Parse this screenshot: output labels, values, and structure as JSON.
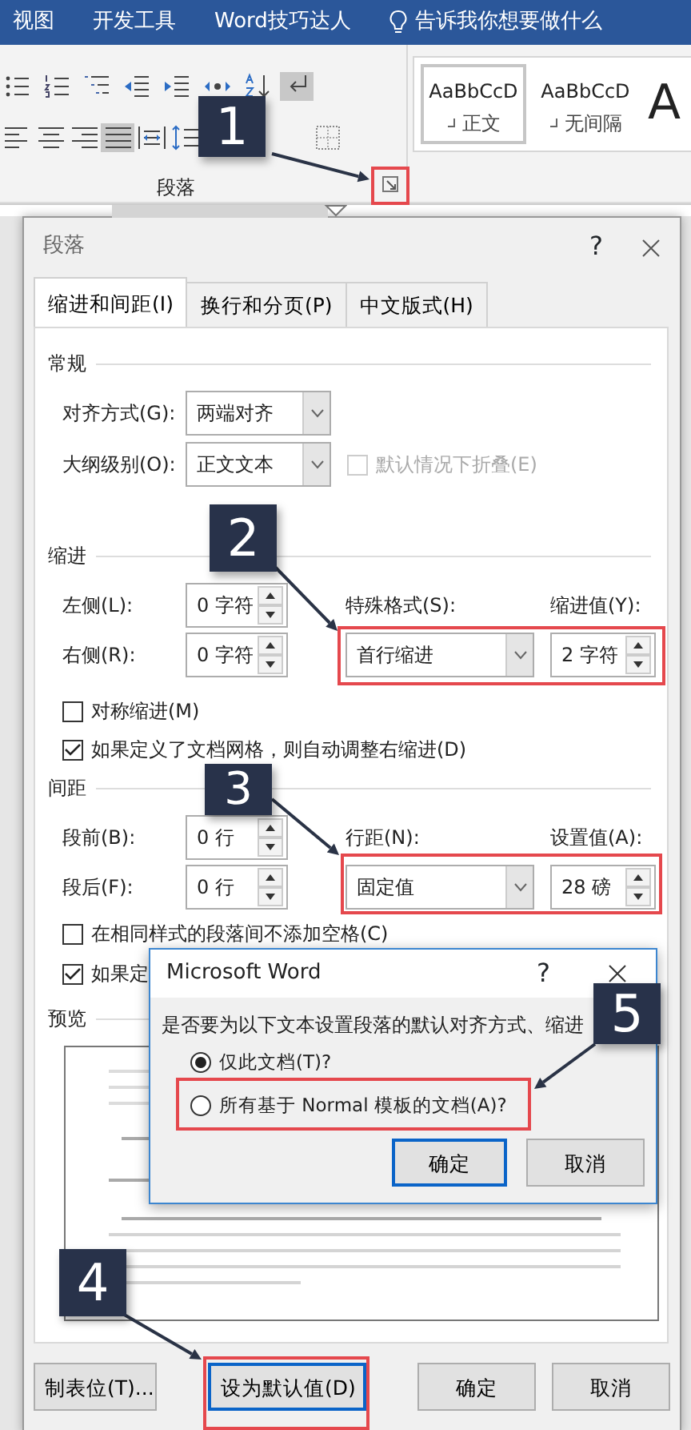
{
  "ribbon_tabs": [
    {
      "label": "视图"
    },
    {
      "label": "开发工具"
    },
    {
      "label": "Word技巧达人"
    }
  ],
  "tell_me": "告诉我你想要做什么",
  "tool_rows": [
    [
      {
        "kind": "bullets",
        "selected": false
      },
      {
        "kind": "numbering",
        "selected": false
      },
      {
        "kind": "multilevel",
        "selected": false
      },
      {
        "kind": "outdent",
        "selected": false
      },
      {
        "kind": "indent",
        "selected": false
      },
      {
        "kind": "asian",
        "selected": false
      },
      {
        "kind": "sort",
        "selected": false
      },
      {
        "kind": "marks",
        "selected": true
      }
    ],
    [
      {
        "kind": "align-left",
        "selected": false
      },
      {
        "kind": "align-center",
        "selected": false
      },
      {
        "kind": "align-right",
        "selected": false
      },
      {
        "kind": "justify",
        "selected": true
      },
      {
        "kind": "distribute",
        "selected": false
      },
      {
        "kind": "line-spacing",
        "selected": false
      },
      {
        "kind": "spacer"
      },
      {
        "kind": "borders",
        "selected": false
      }
    ]
  ],
  "group_label": "段落",
  "styles": [
    {
      "kind": "normal",
      "sample": "AaBbCcD",
      "name": "正文",
      "selected": true
    },
    {
      "kind": "normal",
      "sample": "AaBbCcD",
      "name": "无间隔",
      "selected": false
    },
    {
      "kind": "heading",
      "sample": "A",
      "selected": false
    }
  ],
  "dialog": {
    "title": "段落",
    "help": "?",
    "tabs": [
      {
        "label": "缩进和间距(I)",
        "selected": true
      },
      {
        "label": "换行和分页(P)",
        "selected": false
      },
      {
        "label": "中文版式(H)",
        "selected": false
      }
    ],
    "general": {
      "heading": "常规",
      "alignment": {
        "label": "对齐方式(G):",
        "value": "两端对齐"
      },
      "outline": {
        "label": "大纲级别(O):",
        "value": "正文文本"
      },
      "collapse": {
        "label": "默认情况下折叠(E)",
        "checked": false,
        "disabled": true
      }
    },
    "indent": {
      "heading": "缩进",
      "left": {
        "label": "左侧(L):",
        "value": "0 字符"
      },
      "right": {
        "label": "右侧(R):",
        "value": "0 字符"
      },
      "special": {
        "label": "特殊格式(S):",
        "value": "首行缩进"
      },
      "by": {
        "label": "缩进值(Y):",
        "value": "2 字符"
      },
      "checkboxes": [
        {
          "label": "对称缩进(M)",
          "checked": false
        },
        {
          "label": "如果定义了文档网格，则自动调整右缩进(D)",
          "checked": true
        }
      ]
    },
    "spacing": {
      "heading": "间距",
      "before": {
        "label": "段前(B):",
        "value": "0 行"
      },
      "after": {
        "label": "段后(F):",
        "value": "0 行"
      },
      "special": {
        "label": "行距(N):",
        "value": "固定值"
      },
      "by": {
        "label": "设置值(A):",
        "value": "28 磅"
      },
      "checkboxes": [
        {
          "label": "在相同样式的段落间不添加空格(C)",
          "checked": false
        },
        {
          "label": "如果定",
          "checked": true
        }
      ]
    },
    "preview": {
      "heading": "预览"
    },
    "buttons": [
      {
        "label": "制表位(T)...",
        "focused": false
      },
      {
        "label": "设为默认值(D)",
        "focused": true
      },
      {
        "label": "确定",
        "focused": false
      },
      {
        "label": "取消",
        "focused": false
      }
    ]
  },
  "popup": {
    "title": "Microsoft Word",
    "help": "?",
    "message": "是否要为以下文本设置段落的默认对齐方式、缩进",
    "options": [
      {
        "label": "仅此文档(T)?",
        "selected": true
      },
      {
        "label": "所有基于 Normal 模板的文档(A)?",
        "selected": false
      }
    ],
    "buttons": [
      {
        "label": "确定",
        "focused": true
      },
      {
        "label": "取消",
        "focused": false
      }
    ]
  },
  "callouts": [
    {
      "number": "1"
    },
    {
      "number": "2"
    },
    {
      "number": "3"
    },
    {
      "number": "4"
    },
    {
      "number": "5"
    }
  ]
}
